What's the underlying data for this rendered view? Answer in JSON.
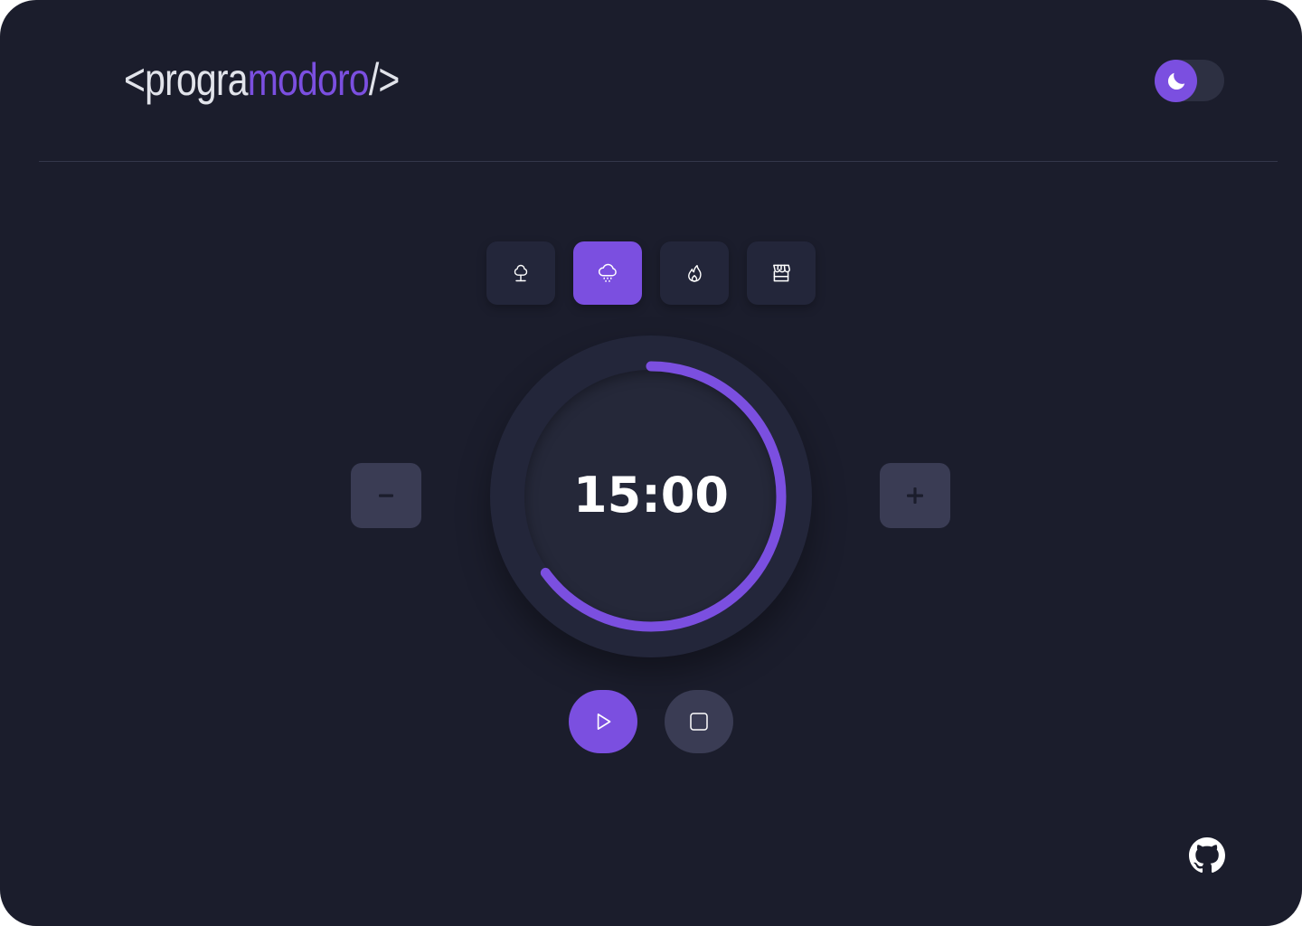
{
  "header": {
    "logo": {
      "prefix": "<progra",
      "accent": "modoro",
      "suffix": "/>"
    },
    "theme_toggle": {
      "mode": "dark",
      "icon": "moon-icon"
    }
  },
  "sound_selector": {
    "items": [
      {
        "name": "forest",
        "icon": "tree-icon",
        "active": false
      },
      {
        "name": "rain",
        "icon": "cloud-rain-icon",
        "active": true
      },
      {
        "name": "fireplace",
        "icon": "flame-icon",
        "active": false
      },
      {
        "name": "coffee-shop",
        "icon": "store-icon",
        "active": false
      }
    ]
  },
  "timer": {
    "display": "15:00",
    "progress_fraction": 0.65,
    "decrease_label": "−",
    "increase_label": "+"
  },
  "controls": {
    "play_icon": "play-icon",
    "stop_icon": "stop-icon"
  },
  "footer": {
    "github_icon": "github-icon"
  },
  "colors": {
    "background": "#1b1d2c",
    "surface": "#23263a",
    "accent": "#7b4fe0",
    "muted_button": "#3a3c54",
    "text": "#ffffff",
    "logo_text": "#e1e3ea"
  }
}
